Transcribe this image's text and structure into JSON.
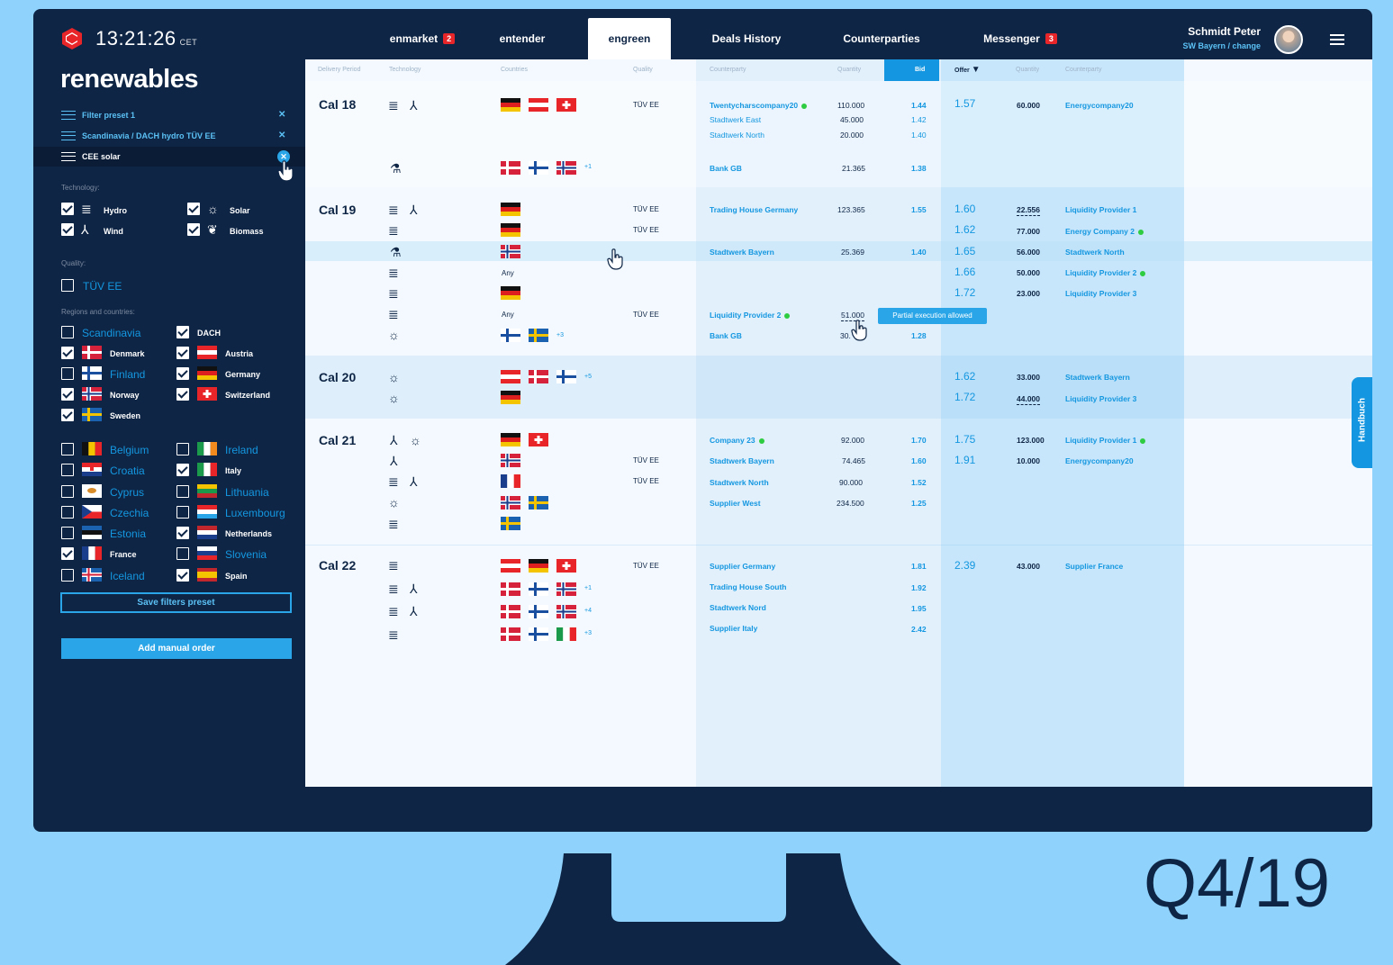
{
  "header": {
    "clock": "13:21:26",
    "tz": "CET",
    "brand": "renewables",
    "user_name": "Schmidt Peter",
    "user_sub": "SW Bayern / change"
  },
  "tabs": [
    {
      "label": "enmarket",
      "badge": "2"
    },
    {
      "label": "entender"
    },
    {
      "label": "engreen"
    },
    {
      "label": "Deals History"
    },
    {
      "label": "Counterparties"
    },
    {
      "label": "Messenger",
      "badge": "3"
    }
  ],
  "presets": [
    "Filter preset 1",
    "Scandinavia / DACH hydro TÜV EE",
    "CEE solar"
  ],
  "sidebar": {
    "technology_label": "Technology:",
    "quality_label": "Quality:",
    "regions_label": "Regions and countries:",
    "tech": [
      "Hydro",
      "Solar",
      "Wind",
      "Biomass"
    ],
    "quality": "TÜV EE",
    "regions": [
      "Scandinavia",
      "DACH",
      "Denmark",
      "Austria",
      "Finland",
      "Germany",
      "Norway",
      "Switzerland",
      "Sweden"
    ],
    "countries": [
      "Belgium",
      "Ireland",
      "Croatia",
      "Italy",
      "Cyprus",
      "Lithuania",
      "Czechia",
      "Luxembourg",
      "Estonia",
      "Netherlands",
      "France",
      "Slovenia",
      "Iceland",
      "Spain"
    ],
    "save_button": "Save filters preset",
    "add_button": "Add manual order"
  },
  "columns": [
    "Delivery Period",
    "Technology",
    "Countries",
    "Quality",
    "Counterparty",
    "Quantity",
    "Bid",
    "Offer",
    "Quantity",
    "Counterparty"
  ],
  "rows": {
    "cal18": {
      "period": "Cal 18",
      "quality": "TÜV EE",
      "more": "+1",
      "bids": [
        [
          "Twentycharscompany20",
          "110.000",
          "1.44"
        ],
        [
          "Stadtwerk East",
          "45.000",
          "1.42"
        ],
        [
          "Stadtwerk North",
          "20.000",
          "1.40"
        ],
        [
          "Bank GB",
          "21.365",
          "1.38"
        ]
      ],
      "offers": [
        [
          "1.57",
          "60.000",
          "Energycompany20"
        ]
      ]
    },
    "cal19": {
      "period": "Cal 19",
      "q1": "TÜV EE",
      "q2": "TÜV EE",
      "q3": "TÜV EE",
      "any1": "Any",
      "any2": "Any",
      "more": "+3",
      "bids": [
        [
          "Trading House Germany",
          "123.365",
          "1.55"
        ],
        [
          "Stadtwerk Bayern",
          "25.369",
          "1.40"
        ],
        [
          "Liquidity Provider 2",
          "51.000",
          ""
        ],
        [
          "Bank GB",
          "30.",
          "1.28"
        ]
      ],
      "offers": [
        [
          "1.60",
          "22.556",
          "Liquidity Provider 1"
        ],
        [
          "1.62",
          "77.000",
          "Energy Company 2"
        ],
        [
          "1.65",
          "56.000",
          "Stadtwerk North"
        ],
        [
          "1.66",
          "50.000",
          "Liquidity Provider 2"
        ],
        [
          "1.72",
          "23.000",
          "Liquidity Provider 3"
        ]
      ],
      "tooltip": "Partial execution allowed"
    },
    "cal20": {
      "period": "Cal 20",
      "more": "+5",
      "offers": [
        [
          "1.62",
          "33.000",
          "Stadtwerk Bayern"
        ],
        [
          "1.72",
          "44.000",
          "Liquidity Provider 3"
        ]
      ]
    },
    "cal21": {
      "period": "Cal 21",
      "q1": "TÜV EE",
      "q2": "TÜV EE",
      "bids": [
        [
          "Company 23",
          "92.000",
          "1.70"
        ],
        [
          "Stadtwerk Bayern",
          "74.465",
          "1.60"
        ],
        [
          "Stadtwerk North",
          "90.000",
          "1.52"
        ],
        [
          "Supplier West",
          "234.500",
          "1.25"
        ]
      ],
      "offers": [
        [
          "1.75",
          "123.000",
          "Liquidity Provider 1"
        ],
        [
          "1.91",
          "10.000",
          "Energycompany20"
        ]
      ]
    },
    "cal22": {
      "period": "Cal 22",
      "quality": "TÜV EE",
      "m1": "+1",
      "m2": "+4",
      "m3": "+3",
      "bids": [
        [
          "Supplier Germany",
          "",
          "1.81"
        ],
        [
          "Trading House South",
          "",
          "1.92"
        ],
        [
          "Stadtwerk Nord",
          "",
          "1.95"
        ],
        [
          "Supplier Italy",
          "",
          "2.42"
        ]
      ],
      "offers": [
        [
          "2.39",
          "43.000",
          "Supplier France"
        ]
      ]
    }
  },
  "handbuch": "Handbuch",
  "caption": "Q4/19",
  "colors": {
    "navy": "#0e2545",
    "blue": "#1497e0",
    "background": "#8fd2fb"
  }
}
